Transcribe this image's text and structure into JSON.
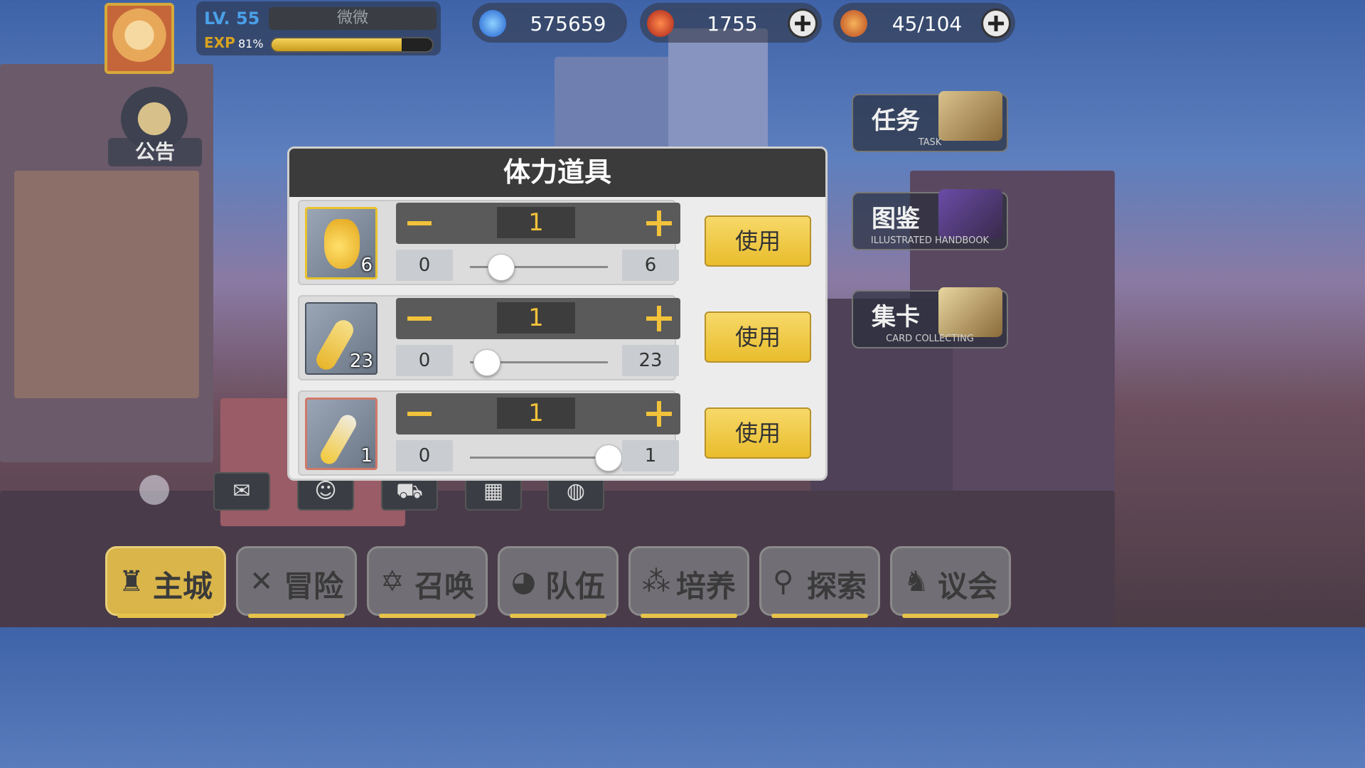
{
  "player": {
    "level_label": "LV.",
    "level": "55",
    "name": "微微",
    "exp_label": "EXP",
    "exp_percent_text": "81%",
    "exp_fraction": 0.81
  },
  "resources": [
    {
      "icon": "blue-flame-icon",
      "value": "575659",
      "has_add": false
    },
    {
      "icon": "red-gem-icon",
      "value": "1755",
      "has_add": true
    },
    {
      "icon": "stamina-food-icon",
      "value": "45/104",
      "has_add": true
    }
  ],
  "notice": {
    "label": "公告"
  },
  "side_buttons": [
    {
      "cn": "任务",
      "en": "TASK"
    },
    {
      "cn": "图鉴",
      "en": "ILLUSTRATED HANDBOOK"
    },
    {
      "cn": "集卡",
      "en": "CARD COLLECTING"
    }
  ],
  "dialog": {
    "title": "体力道具",
    "use_label": "使用",
    "items": [
      {
        "icon": "large-potion-icon",
        "count": "6",
        "qty": "1",
        "min": "0",
        "max": "6",
        "slider_fraction": 0.22
      },
      {
        "icon": "medium-potion-icon",
        "count": "23",
        "qty": "1",
        "min": "0",
        "max": "23",
        "slider_fraction": 0.12
      },
      {
        "icon": "small-potion-icon",
        "count": "1",
        "qty": "1",
        "min": "0",
        "max": "1",
        "slider_fraction": 1.0
      }
    ]
  },
  "quick_icons": [
    "mail-icon",
    "friends-icon",
    "shop-cart-icon",
    "gift-icon",
    "guild-icon"
  ],
  "nav": [
    {
      "label": "主城",
      "icon": "castle-icon",
      "active": true
    },
    {
      "label": "冒险",
      "icon": "crossed-swords-icon",
      "active": false
    },
    {
      "label": "召唤",
      "icon": "summon-star-icon",
      "active": false
    },
    {
      "label": "队伍",
      "icon": "team-icon",
      "active": false
    },
    {
      "label": "培养",
      "icon": "train-icon",
      "active": false
    },
    {
      "label": "探索",
      "icon": "explore-icon",
      "active": false
    },
    {
      "label": "议会",
      "icon": "council-icon",
      "active": false
    }
  ]
}
